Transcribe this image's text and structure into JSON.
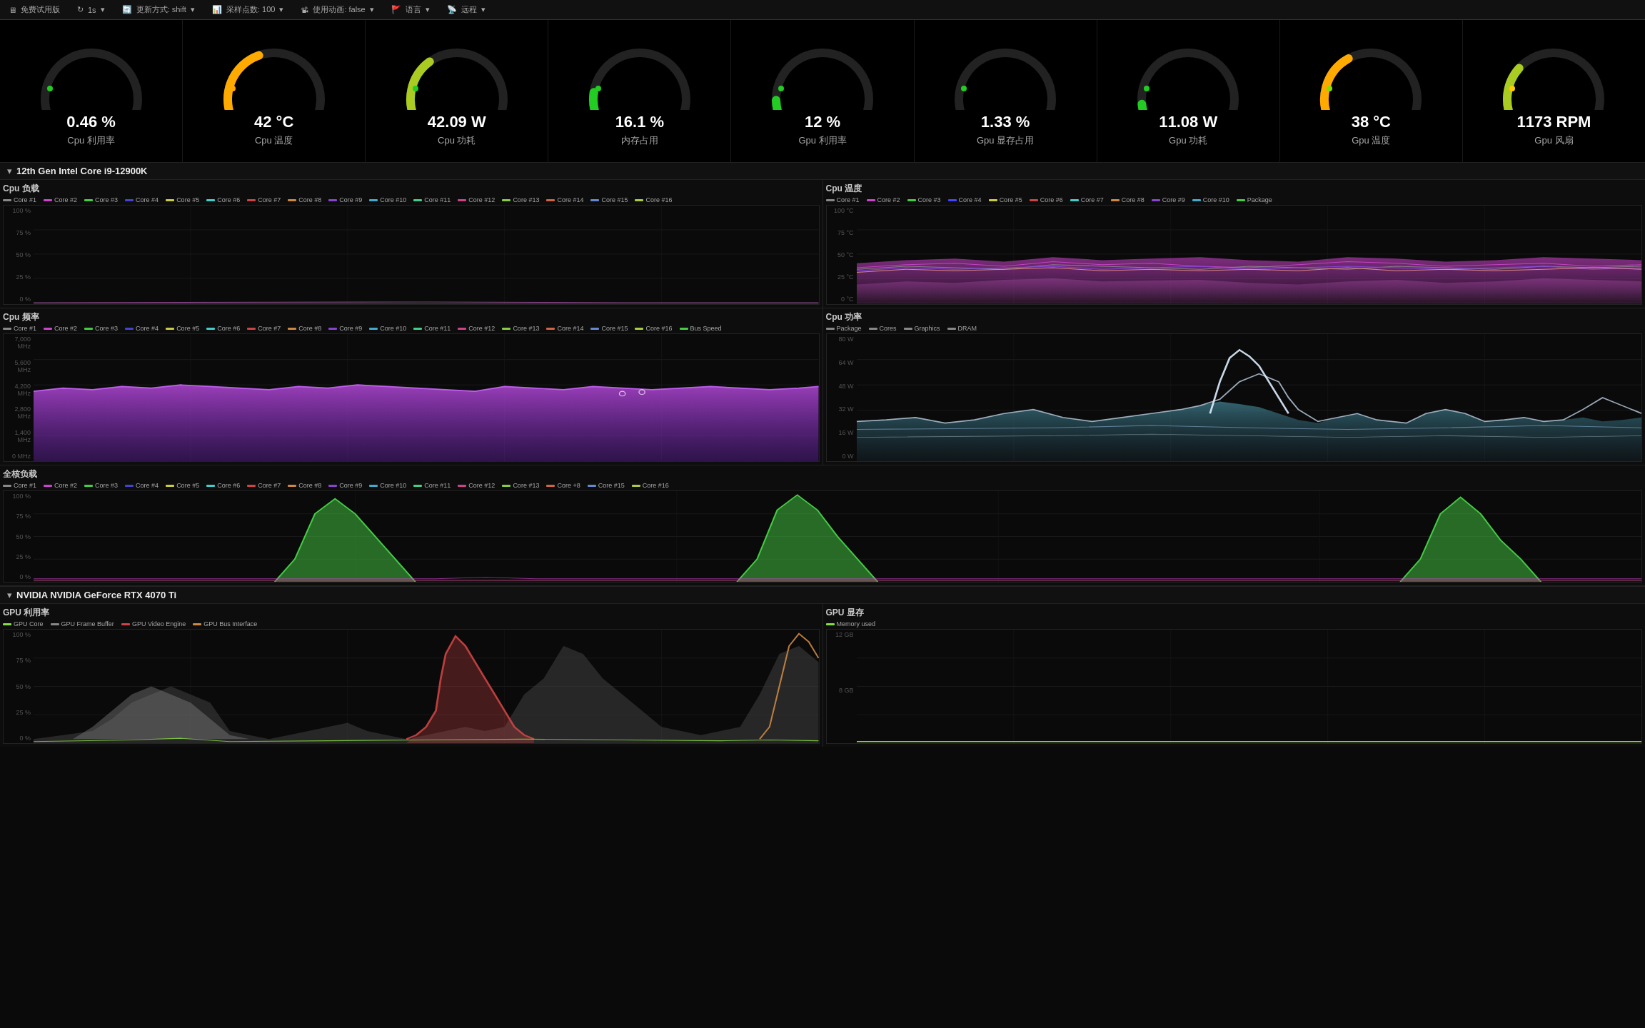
{
  "toolbar": {
    "items": [
      {
        "id": "trial",
        "icon": "🖥",
        "label": "免费试用版"
      },
      {
        "id": "refresh",
        "icon": "↻",
        "label": "1s",
        "suffix": "▾"
      },
      {
        "id": "update",
        "icon": "🔄",
        "label": "更新方式: shift",
        "suffix": "▾"
      },
      {
        "id": "samples",
        "icon": "📊",
        "label": "采样点数: 100",
        "suffix": "▾"
      },
      {
        "id": "animation",
        "icon": "📽",
        "label": "使用动画: false",
        "suffix": "▾"
      },
      {
        "id": "lang",
        "icon": "🚩",
        "label": "语言",
        "suffix": "▾"
      },
      {
        "id": "remote",
        "icon": "📡",
        "label": "远程",
        "suffix": "▾"
      }
    ]
  },
  "gauges": [
    {
      "id": "cpu-util",
      "value": "0.46 %",
      "label": "Cpu 利用率",
      "pct": 0.0046,
      "color": "#22cc22",
      "arcColor": "#22cc22"
    },
    {
      "id": "cpu-temp",
      "value": "42 °C",
      "label": "Cpu 温度",
      "pct": 0.42,
      "color": "#ffaa00",
      "arcColor": "#ffaa00"
    },
    {
      "id": "cpu-power",
      "value": "42.09 W",
      "label": "Cpu 功耗",
      "pct": 0.35,
      "color": "#22cc22",
      "arcColor": "#22cc22"
    },
    {
      "id": "mem-usage",
      "value": "16.1 %",
      "label": "内存占用",
      "pct": 0.161,
      "color": "#22cc22",
      "arcColor": "#22cc22"
    },
    {
      "id": "gpu-util",
      "value": "12 %",
      "label": "Gpu 利用率",
      "pct": 0.12,
      "color": "#22cc22",
      "arcColor": "#22cc22"
    },
    {
      "id": "gpu-mem",
      "value": "1.33 %",
      "label": "Gpu 显存占用",
      "pct": 0.013,
      "color": "#22cc22",
      "arcColor": "#22cc22"
    },
    {
      "id": "gpu-power",
      "value": "11.08 W",
      "label": "Gpu 功耗",
      "pct": 0.1,
      "color": "#22cc22",
      "arcColor": "#22cc22"
    },
    {
      "id": "gpu-temp",
      "value": "38 °C",
      "label": "Gpu 温度",
      "pct": 0.38,
      "color": "#88dd00",
      "arcColor": "#88dd00"
    },
    {
      "id": "gpu-fan",
      "value": "1173 RPM",
      "label": "Gpu 风扇",
      "pct": 0.3,
      "color": "#ffcc00",
      "arcColor": "#ffcc00"
    }
  ],
  "cpu_section": {
    "title": "12th Gen Intel Core i9-12900K",
    "cpu_load": {
      "title": "Cpu 负载",
      "y_labels": [
        "100 %",
        "75 %",
        "50 %",
        "25 %",
        "0 %"
      ],
      "legend": [
        {
          "label": "Core #1",
          "color": "#888888"
        },
        {
          "label": "Core #2",
          "color": "#cc44cc"
        },
        {
          "label": "Core #3",
          "color": "#44cc44"
        },
        {
          "label": "Core #4",
          "color": "#4444cc"
        },
        {
          "label": "Core #5",
          "color": "#cccc44"
        },
        {
          "label": "Core #6",
          "color": "#44cccc"
        },
        {
          "label": "Core #7",
          "color": "#cc4444"
        },
        {
          "label": "Core #8",
          "color": "#cc8844"
        },
        {
          "label": "Core #9",
          "color": "#8844cc"
        },
        {
          "label": "Core #10",
          "color": "#44aacc"
        },
        {
          "label": "Core #11",
          "color": "#44cc88"
        },
        {
          "label": "Core #12",
          "color": "#cc4488"
        },
        {
          "label": "Core #13",
          "color": "#88cc44"
        },
        {
          "label": "Core #14",
          "color": "#cc6644"
        },
        {
          "label": "Core #15",
          "color": "#6688cc"
        },
        {
          "label": "Core #16",
          "color": "#aacc44"
        }
      ]
    },
    "cpu_temp": {
      "title": "Cpu 温度",
      "y_labels": [
        "100 °C",
        "75 °C",
        "50 °C",
        "25 °C",
        "0 °C"
      ],
      "legend": [
        {
          "label": "Core #1",
          "color": "#888"
        },
        {
          "label": "Core #2",
          "color": "#cc44cc"
        },
        {
          "label": "Core #3",
          "color": "#44cc44"
        },
        {
          "label": "Core #4",
          "color": "#4444ff"
        },
        {
          "label": "Core #5",
          "color": "#cccc44"
        },
        {
          "label": "Core #6",
          "color": "#cc4444"
        },
        {
          "label": "Core #7",
          "color": "#44cccc"
        },
        {
          "label": "Core #8",
          "color": "#cc8844"
        },
        {
          "label": "Core #9",
          "color": "#8844cc"
        },
        {
          "label": "Core #10",
          "color": "#44aacc"
        },
        {
          "label": "Package",
          "color": "#44cc44"
        }
      ]
    },
    "cpu_freq": {
      "title": "Cpu 频率",
      "y_labels": [
        "7,000 MHz",
        "5,600 MHz",
        "4,200 MHz",
        "2,800 MHz",
        "1,400 MHz",
        "0 MHz"
      ],
      "legend": [
        {
          "label": "Core #1",
          "color": "#888"
        },
        {
          "label": "Core #2",
          "color": "#cc44cc"
        },
        {
          "label": "Core #3",
          "color": "#44cc44"
        },
        {
          "label": "Core #4",
          "color": "#4444cc"
        },
        {
          "label": "Core #5",
          "color": "#cccc44"
        },
        {
          "label": "Core #6",
          "color": "#44cccc"
        },
        {
          "label": "Core #7",
          "color": "#cc4444"
        },
        {
          "label": "Core #8",
          "color": "#cc8844"
        },
        {
          "label": "Core #9",
          "color": "#8844cc"
        },
        {
          "label": "Core #10",
          "color": "#44aacc"
        },
        {
          "label": "Core #11",
          "color": "#44cc88"
        },
        {
          "label": "Core #12",
          "color": "#cc4488"
        },
        {
          "label": "Core #13",
          "color": "#88cc44"
        },
        {
          "label": "Core #14",
          "color": "#cc6644"
        },
        {
          "label": "Core #15",
          "color": "#6688cc"
        },
        {
          "label": "Core #16",
          "color": "#aacc44"
        },
        {
          "label": "Bus Speed",
          "color": "#44cc44"
        }
      ]
    },
    "cpu_power": {
      "title": "Cpu 功率",
      "y_labels": [
        "80 W",
        "64 W",
        "48 W",
        "32 W",
        "16 W",
        "0 W"
      ],
      "legend": [
        {
          "label": "Package",
          "color": "#888"
        },
        {
          "label": "Cores",
          "color": "#888"
        },
        {
          "label": "Graphics",
          "color": "#888"
        },
        {
          "label": "DRAM",
          "color": "#888"
        }
      ]
    },
    "all_cores": {
      "title": "全核负载",
      "y_labels": [
        "100 %",
        "75 %",
        "50 %",
        "25 %",
        "0 %"
      ],
      "legend": [
        {
          "label": "Core #1",
          "color": "#888"
        },
        {
          "label": "Core #2",
          "color": "#cc44cc"
        },
        {
          "label": "Core #3",
          "color": "#44cc44"
        },
        {
          "label": "Core #4",
          "color": "#4444cc"
        },
        {
          "label": "Core #5",
          "color": "#cccc44"
        },
        {
          "label": "Core #6",
          "color": "#44cccc"
        },
        {
          "label": "Core #7",
          "color": "#cc4444"
        },
        {
          "label": "Core #8",
          "color": "#cc8844"
        },
        {
          "label": "Core #9",
          "color": "#8844cc"
        },
        {
          "label": "Core #10",
          "color": "#44aacc"
        },
        {
          "label": "Core #11",
          "color": "#44cc88"
        },
        {
          "label": "Core #12",
          "color": "#cc4488"
        },
        {
          "label": "Core #13",
          "color": "#88cc44"
        },
        {
          "label": "Core +8",
          "color": "#cc6644"
        },
        {
          "label": "Core #15",
          "color": "#6688cc"
        },
        {
          "label": "Core #16",
          "color": "#aacc44"
        }
      ]
    }
  },
  "gpu_section": {
    "title": "NVIDIA NVIDIA GeForce RTX 4070 Ti",
    "gpu_util": {
      "title": "GPU 利用率",
      "y_labels": [
        "100 %",
        "75 %",
        "50 %",
        "25 %",
        "0 %"
      ],
      "legend": [
        {
          "label": "GPU Core",
          "color": "#88dd44"
        },
        {
          "label": "GPU Frame Buffer",
          "color": "#888"
        },
        {
          "label": "GPU Video Engine",
          "color": "#cc4444"
        },
        {
          "label": "GPU Bus Interface",
          "color": "#cc8844"
        }
      ]
    },
    "gpu_mem": {
      "title": "GPU 显存",
      "y_labels": [
        "12 GB",
        "8 GB"
      ],
      "legend": [
        {
          "label": "Memory used",
          "color": "#88dd44"
        }
      ]
    }
  }
}
